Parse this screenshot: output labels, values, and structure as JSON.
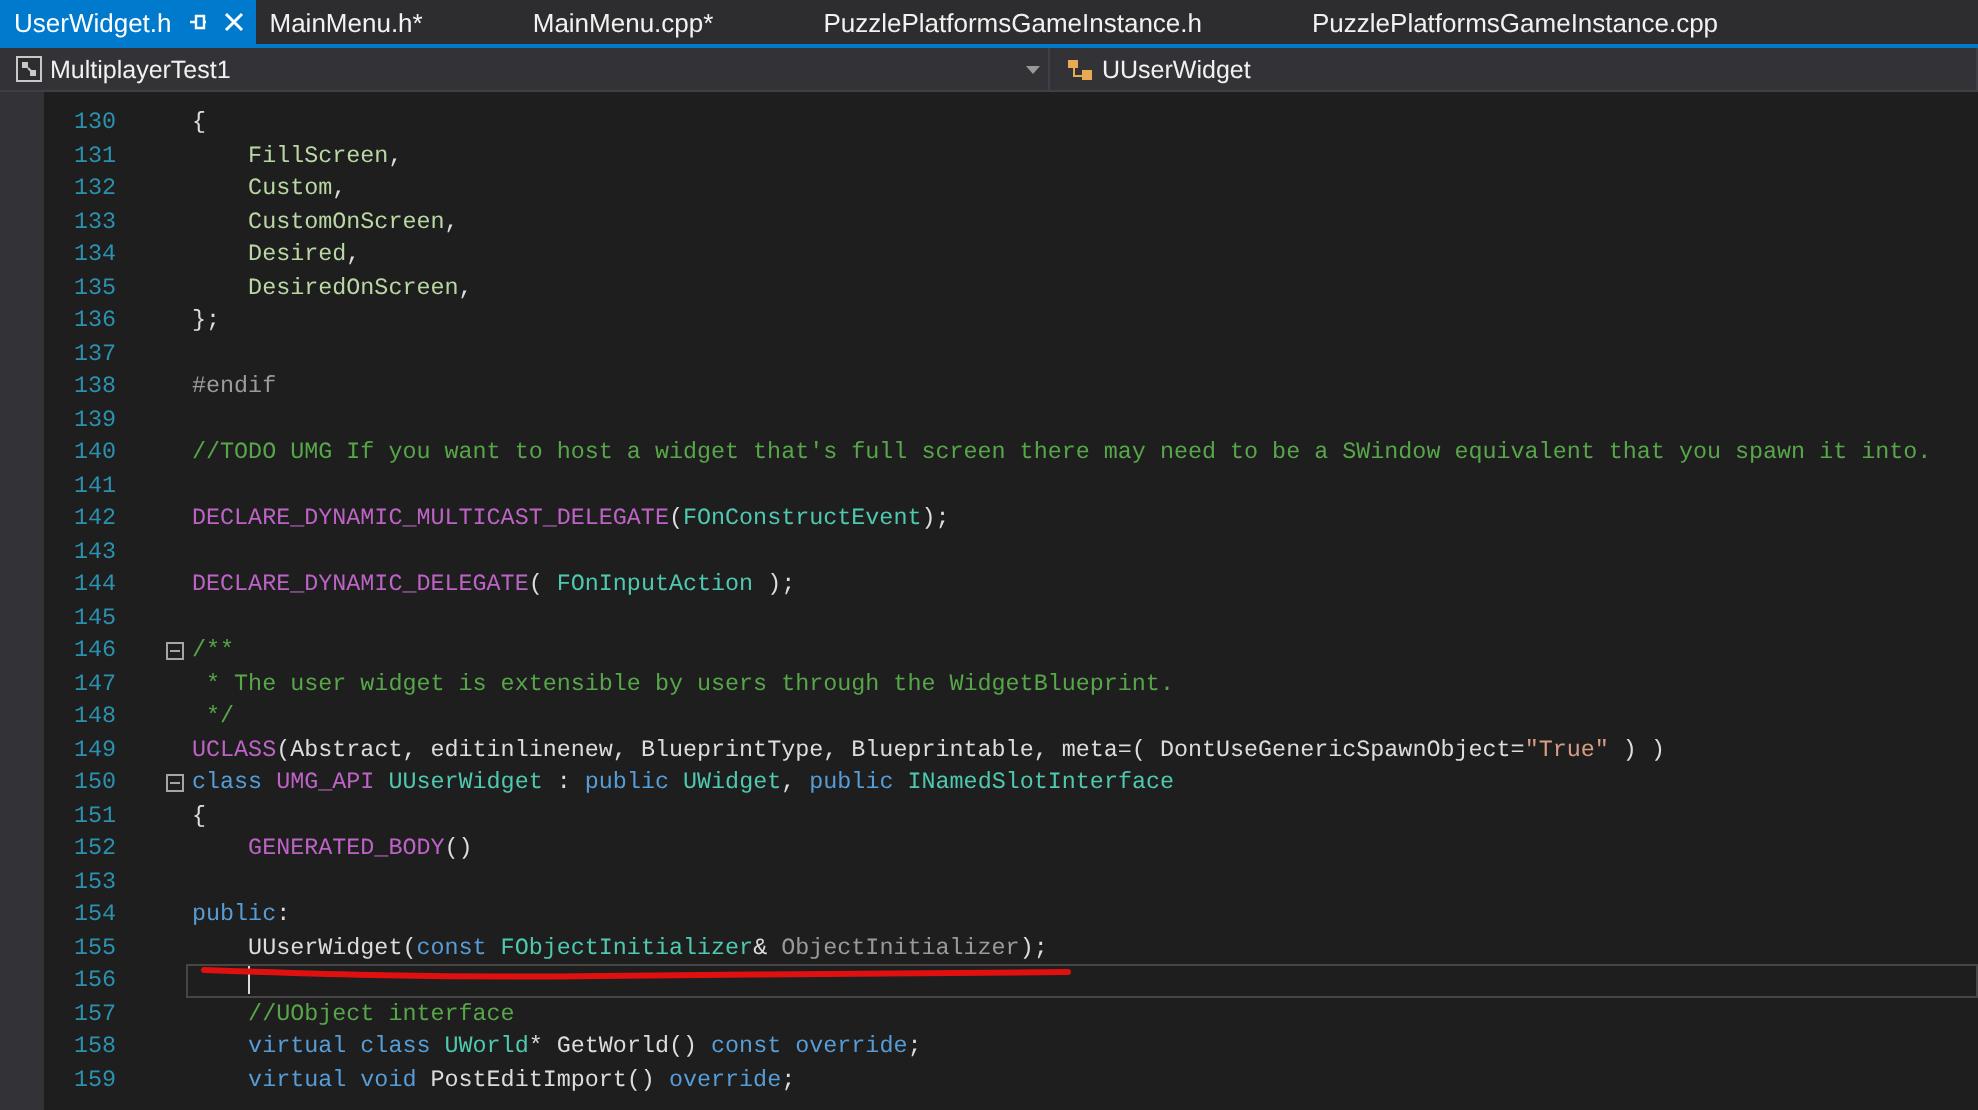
{
  "tabs": [
    {
      "label": "UserWidget.h",
      "selected": true
    },
    {
      "label": "MainMenu.h*",
      "selected": false
    },
    {
      "label": "MainMenu.cpp*",
      "selected": false
    },
    {
      "label": "PuzzlePlatformsGameInstance.h",
      "selected": false
    },
    {
      "label": "PuzzlePlatformsGameInstance.cpp",
      "selected": false
    }
  ],
  "navigation": {
    "project": "MultiplayerTest1",
    "scope": "UUserWidget"
  },
  "lines": [
    {
      "number": "130",
      "fold": false,
      "current": false,
      "tokens": [
        {
          "kind": "plain",
          "text": "{"
        }
      ]
    },
    {
      "number": "131",
      "fold": false,
      "current": false,
      "tokens": [
        {
          "kind": "enum",
          "text": "    FillScreen"
        },
        {
          "kind": "plain",
          "text": ","
        }
      ]
    },
    {
      "number": "132",
      "fold": false,
      "current": false,
      "tokens": [
        {
          "kind": "enum",
          "text": "    Custom"
        },
        {
          "kind": "plain",
          "text": ","
        }
      ]
    },
    {
      "number": "133",
      "fold": false,
      "current": false,
      "tokens": [
        {
          "kind": "enum",
          "text": "    CustomOnScreen"
        },
        {
          "kind": "plain",
          "text": ","
        }
      ]
    },
    {
      "number": "134",
      "fold": false,
      "current": false,
      "tokens": [
        {
          "kind": "enum",
          "text": "    Desired"
        },
        {
          "kind": "plain",
          "text": ","
        }
      ]
    },
    {
      "number": "135",
      "fold": false,
      "current": false,
      "tokens": [
        {
          "kind": "enum",
          "text": "    DesiredOnScreen"
        },
        {
          "kind": "plain",
          "text": ","
        }
      ]
    },
    {
      "number": "136",
      "fold": false,
      "current": false,
      "tokens": [
        {
          "kind": "plain",
          "text": "};"
        }
      ]
    },
    {
      "number": "137",
      "fold": false,
      "current": false
    },
    {
      "number": "138",
      "fold": false,
      "current": false,
      "tokens": [
        {
          "kind": "preprocessor",
          "text": "#endif"
        }
      ]
    },
    {
      "number": "139",
      "fold": false,
      "current": false
    },
    {
      "number": "140",
      "fold": false,
      "current": false,
      "tokens": [
        {
          "kind": "comment",
          "text": "//TODO UMG If you want to host a widget that's full screen there may need to be a SWindow equivalent that you spawn it into."
        }
      ]
    },
    {
      "number": "141",
      "fold": false,
      "current": false
    },
    {
      "number": "142",
      "fold": false,
      "current": false,
      "tokens": [
        {
          "kind": "macro",
          "text": "DECLARE_DYNAMIC_MULTICAST_DELEGATE"
        },
        {
          "kind": "plain",
          "text": "("
        },
        {
          "kind": "type",
          "text": "FOnConstructEvent"
        },
        {
          "kind": "plain",
          "text": ");"
        }
      ]
    },
    {
      "number": "143",
      "fold": false,
      "current": false
    },
    {
      "number": "144",
      "fold": false,
      "current": false,
      "tokens": [
        {
          "kind": "macro",
          "text": "DECLARE_DYNAMIC_DELEGATE"
        },
        {
          "kind": "plain",
          "text": "( "
        },
        {
          "kind": "type",
          "text": "FOnInputAction"
        },
        {
          "kind": "plain",
          "text": " );"
        }
      ]
    },
    {
      "number": "145",
      "fold": false,
      "current": false
    },
    {
      "number": "146",
      "fold": true,
      "current": false,
      "tokens": [
        {
          "kind": "comment",
          "text": "/**"
        }
      ]
    },
    {
      "number": "147",
      "fold": false,
      "current": false,
      "tokens": [
        {
          "kind": "comment",
          "text": " * The user widget is extensible by users through the WidgetBlueprint."
        }
      ]
    },
    {
      "number": "148",
      "fold": false,
      "current": false,
      "tokens": [
        {
          "kind": "comment",
          "text": " */"
        }
      ]
    },
    {
      "number": "149",
      "fold": false,
      "current": false,
      "tokens": [
        {
          "kind": "macro",
          "text": "UCLASS"
        },
        {
          "kind": "plain",
          "text": "(Abstract, editinlinenew, BlueprintType, Blueprintable, meta=( DontUseGenericSpawnObject="
        },
        {
          "kind": "string",
          "text": "\"True\""
        },
        {
          "kind": "plain",
          "text": " ) )"
        }
      ]
    },
    {
      "number": "150",
      "fold": true,
      "current": false,
      "tokens": [
        {
          "kind": "keyword",
          "text": "class"
        },
        {
          "kind": "macro",
          "text": " UMG_API"
        },
        {
          "kind": "type",
          "text": " UUserWidget"
        },
        {
          "kind": "plain",
          "text": " : "
        },
        {
          "kind": "keyword",
          "text": "public"
        },
        {
          "kind": "type",
          "text": " UWidget"
        },
        {
          "kind": "plain",
          "text": ", "
        },
        {
          "kind": "keyword",
          "text": "public"
        },
        {
          "kind": "type",
          "text": " INamedSlotInterface"
        }
      ]
    },
    {
      "number": "151",
      "fold": false,
      "current": false,
      "tokens": [
        {
          "kind": "plain",
          "text": "{"
        }
      ]
    },
    {
      "number": "152",
      "fold": false,
      "current": false,
      "tokens": [
        {
          "kind": "macro",
          "text": "    GENERATED_BODY"
        },
        {
          "kind": "plain",
          "text": "()"
        }
      ]
    },
    {
      "number": "153",
      "fold": false,
      "current": false
    },
    {
      "number": "154",
      "fold": false,
      "current": false,
      "tokens": [
        {
          "kind": "keyword",
          "text": "public"
        },
        {
          "kind": "plain",
          "text": ":"
        }
      ]
    },
    {
      "number": "155",
      "fold": false,
      "current": false,
      "tokens": [
        {
          "kind": "plain",
          "text": "    UUserWidget("
        },
        {
          "kind": "keyword",
          "text": "const"
        },
        {
          "kind": "type",
          "text": " FObjectInitializer"
        },
        {
          "kind": "plain",
          "text": "& "
        },
        {
          "kind": "param",
          "text": "ObjectInitializer"
        },
        {
          "kind": "plain",
          "text": ");"
        }
      ]
    },
    {
      "number": "156",
      "fold": false,
      "current": true
    },
    {
      "number": "157",
      "fold": false,
      "current": false,
      "tokens": [
        {
          "kind": "comment",
          "text": "    //UObject interface"
        }
      ]
    },
    {
      "number": "158",
      "fold": false,
      "current": false,
      "tokens": [
        {
          "kind": "keyword",
          "text": "    virtual class"
        },
        {
          "kind": "type",
          "text": " UWorld"
        },
        {
          "kind": "plain",
          "text": "* GetWorld() "
        },
        {
          "kind": "keyword",
          "text": "const override"
        },
        {
          "kind": "plain",
          "text": ";"
        }
      ]
    },
    {
      "number": "159",
      "fold": false,
      "current": false,
      "tokens": [
        {
          "kind": "keyword",
          "text": "    virtual void"
        },
        {
          "kind": "plain",
          "text": " PostEditImport() "
        },
        {
          "kind": "keyword",
          "text": "override"
        },
        {
          "kind": "plain",
          "text": ";"
        }
      ]
    }
  ]
}
